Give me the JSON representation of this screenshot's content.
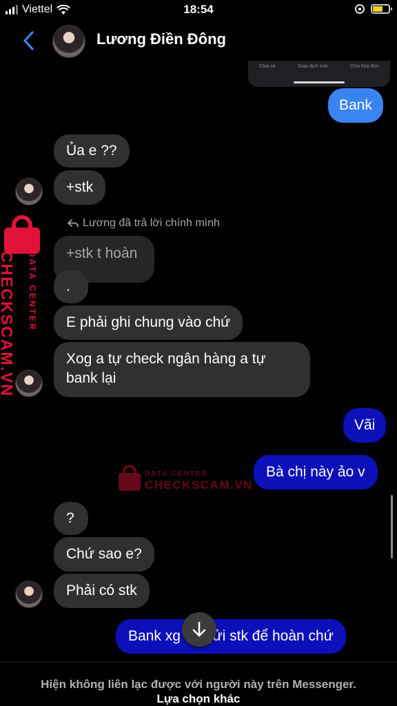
{
  "status_bar": {
    "carrier": "Viettel",
    "time": "18:54"
  },
  "header": {
    "contact_name": "Lương Điền Đông",
    "back_icon": "chevron-left-icon",
    "accent": "#3a84f2"
  },
  "shared_image": {
    "options": [
      "Chia sẻ",
      "Giao dịch mới",
      "Chia hóa đơn"
    ]
  },
  "messages": [
    {
      "side": "out",
      "text": "Bank"
    },
    {
      "side": "in",
      "text": "Ủa e ??"
    },
    {
      "side": "in",
      "text": "+stk"
    },
    {
      "side": "in",
      "text": "+stk t hoàn",
      "reply_note": "Lương đã trả lời chính mình"
    },
    {
      "side": "in",
      "text": "."
    },
    {
      "side": "in",
      "text": "E phải ghi chung vào chứ"
    },
    {
      "side": "in",
      "text": "Xog a tự check ngân hàng a tự bank lại"
    },
    {
      "side": "out",
      "text": "Vãi"
    },
    {
      "side": "out",
      "text": "Bà chị này ảo v"
    },
    {
      "side": "in",
      "text": "?"
    },
    {
      "side": "in",
      "text": "Chứ sao e?"
    },
    {
      "side": "in",
      "text": "Phải có stk"
    },
    {
      "side": "out",
      "text": "Bank xg thì gửi stk để hoàn chứ"
    }
  ],
  "watermark": {
    "main": "CHECKSCAM.VN",
    "sub": "DATA CENTER",
    "color": "#e0133a"
  },
  "colors": {
    "outgoing_light": "#3a84f2",
    "outgoing_dark": "#0d0fb8",
    "incoming": "#303030"
  },
  "footer": {
    "message": "Hiện không liên lạc được với người này trên Messenger.",
    "action": "Lựa chọn khác"
  }
}
